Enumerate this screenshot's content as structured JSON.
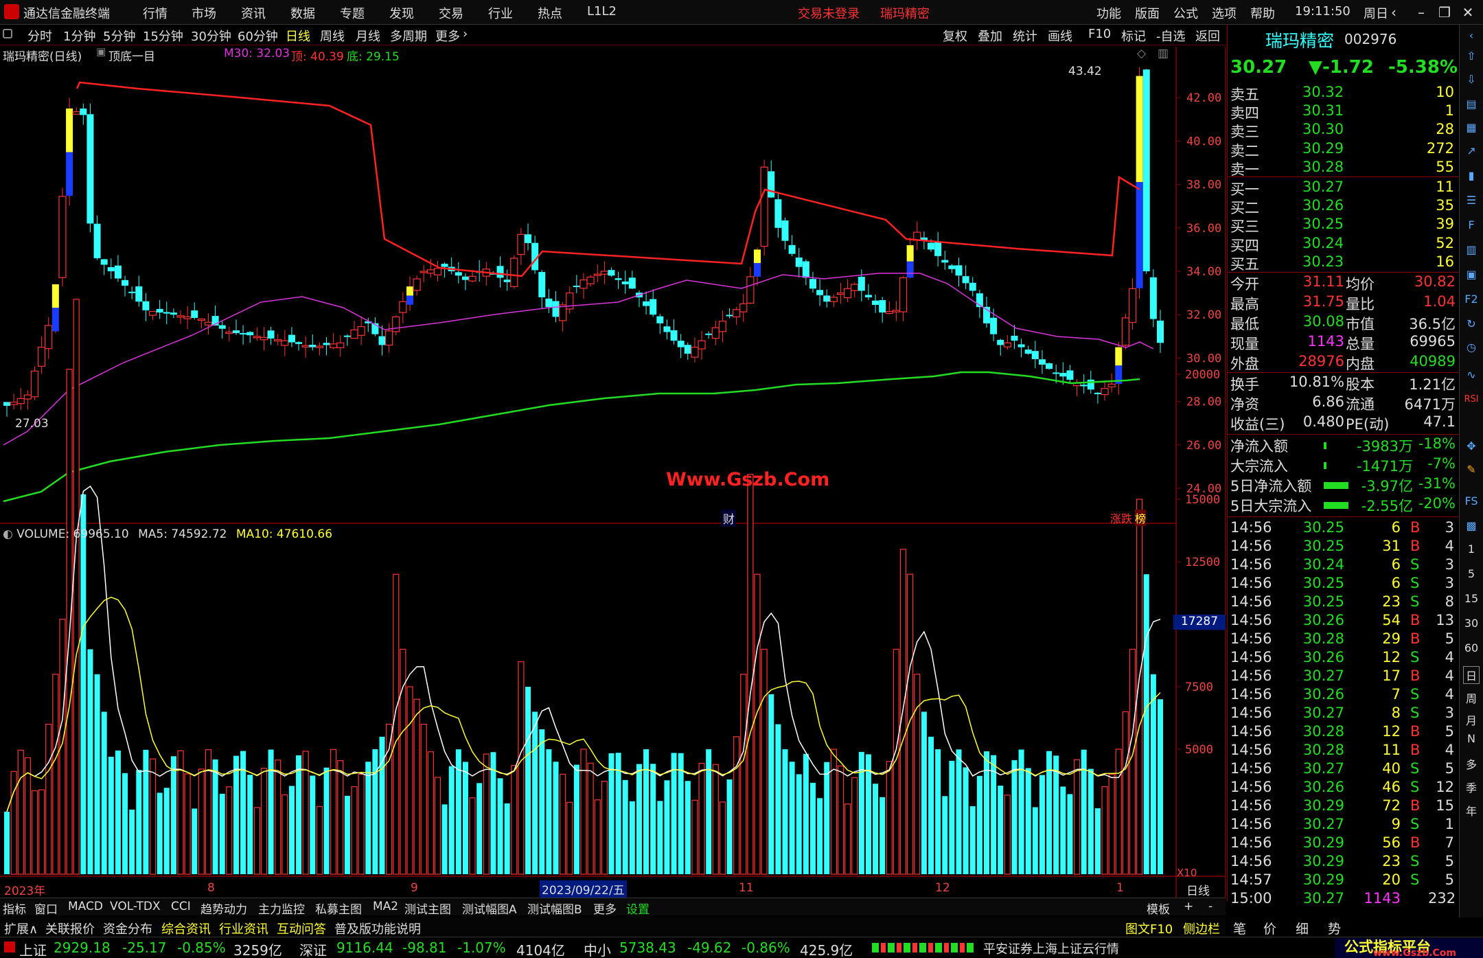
{
  "menubar": {
    "app_title": "通达信金融终端",
    "items": [
      "行情",
      "市场",
      "资讯",
      "数据",
      "专题",
      "发现",
      "交易",
      "行业",
      "热点",
      "L1L2"
    ],
    "trade_status": "交易未登录",
    "stock_name": "瑞玛精密",
    "right_items": [
      "功能",
      "版面",
      "公式",
      "选项",
      "帮助"
    ],
    "time": "19:11:50",
    "weekday": "周日"
  },
  "toolbar": {
    "periods": [
      "分时",
      "1分钟",
      "5分钟",
      "15分钟",
      "30分钟",
      "60分钟",
      "日线",
      "周线",
      "月线",
      "多周期",
      "更多"
    ],
    "active": "日线",
    "right": [
      "复权",
      "叠加",
      "统计",
      "画线",
      "F10",
      "标记",
      "-自选",
      "返回"
    ]
  },
  "chart": {
    "title": "瑞玛精密(日线)",
    "indicator": "顶底一目",
    "m30_label": "M30: 32.03",
    "top_label": "顶: 40.39",
    "bottom_label": "底: 29.15",
    "price_ticks": [
      "42.00",
      "40.00",
      "38.00",
      "36.00",
      "34.00",
      "32.00",
      "30.00",
      "28.00",
      "26.00",
      "24.00"
    ],
    "high_marker": "43.42",
    "low_marker": "27.03",
    "watermark": "Www.Gszb.Com",
    "cai_label": "财",
    "rank_label": "涨跌",
    "bang_label": "榜",
    "volume_header": "VOLUME: 69965.10",
    "ma5_header": "MA5: 74592.72",
    "ma10_header": "MA10: 47610.66",
    "vol_ticks": [
      "20000",
      "15000",
      "12500",
      "10000",
      "7500",
      "5000"
    ],
    "vol_marker": "17287",
    "vol_unit": "X10",
    "date_labels": [
      "2023年",
      "8",
      "9",
      "2023/09/22/五",
      "11",
      "12",
      "1"
    ],
    "period_label": "日线",
    "colors": {
      "up": "#ff3333",
      "down": "#33ffff",
      "ma_top": "#ff2222",
      "ma30": "#dd33dd",
      "bottom": "#22dd22"
    }
  },
  "quote": {
    "name": "瑞玛精密",
    "code": "002976",
    "price": "30.27",
    "change": "▼-1.72",
    "pct": "-5.38%",
    "asks": [
      {
        "label": "卖五",
        "price": "30.32",
        "vol": "10"
      },
      {
        "label": "卖四",
        "price": "30.31",
        "vol": "1"
      },
      {
        "label": "卖三",
        "price": "30.30",
        "vol": "28"
      },
      {
        "label": "卖二",
        "price": "30.29",
        "vol": "272"
      },
      {
        "label": "卖一",
        "price": "30.28",
        "vol": "55"
      }
    ],
    "bids": [
      {
        "label": "买一",
        "price": "30.27",
        "vol": "11"
      },
      {
        "label": "买二",
        "price": "30.26",
        "vol": "35"
      },
      {
        "label": "买三",
        "price": "30.25",
        "vol": "39"
      },
      {
        "label": "买四",
        "price": "30.24",
        "vol": "52"
      },
      {
        "label": "买五",
        "price": "30.23",
        "vol": "16"
      }
    ],
    "stats": [
      {
        "l1": "今开",
        "v1": "31.11",
        "c1": "r",
        "l2": "均价",
        "v2": "30.82",
        "c2": "r"
      },
      {
        "l1": "最高",
        "v1": "31.75",
        "c1": "r",
        "l2": "量比",
        "v2": "1.04",
        "c2": "r"
      },
      {
        "l1": "最低",
        "v1": "30.08",
        "c1": "g",
        "l2": "市值",
        "v2": "36.5亿",
        "c2": "w"
      },
      {
        "l1": "现量",
        "v1": "1143",
        "c1": "m",
        "l2": "总量",
        "v2": "69965",
        "c2": "w"
      },
      {
        "l1": "外盘",
        "v1": "28976",
        "c1": "r",
        "l2": "内盘",
        "v2": "40989",
        "c2": "g"
      }
    ],
    "stats2": [
      {
        "l1": "换手",
        "v1": "10.81%",
        "l2": "股本",
        "v2": "1.21亿"
      },
      {
        "l1": "净资",
        "v1": "6.86",
        "l2": "流通",
        "v2": "6471万"
      },
      {
        "l1": "收益(三)",
        "v1": "0.480",
        "l2": "PE(动)",
        "v2": "47.1"
      }
    ],
    "flows": [
      {
        "label": "净流入额",
        "value": "-3983万",
        "pct": "-18%"
      },
      {
        "label": "大宗流入",
        "value": "-1471万",
        "pct": "-7%"
      },
      {
        "label": "5日净流入额",
        "value": "-3.97亿",
        "pct": "-31%"
      },
      {
        "label": "5日大宗流入",
        "value": "-2.55亿",
        "pct": "-20%"
      }
    ],
    "ticks": [
      {
        "t": "14:56",
        "p": "30.25",
        "pc": "g",
        "v": "6",
        "s": "B",
        "n": "3"
      },
      {
        "t": "14:56",
        "p": "30.25",
        "pc": "g",
        "v": "31",
        "s": "B",
        "n": "4"
      },
      {
        "t": "14:56",
        "p": "30.24",
        "pc": "g",
        "v": "6",
        "s": "S",
        "n": "3"
      },
      {
        "t": "14:56",
        "p": "30.25",
        "pc": "g",
        "v": "6",
        "s": "S",
        "n": "3"
      },
      {
        "t": "14:56",
        "p": "30.25",
        "pc": "g",
        "v": "23",
        "s": "S",
        "n": "8"
      },
      {
        "t": "14:56",
        "p": "30.26",
        "pc": "g",
        "v": "54",
        "s": "B",
        "n": "13"
      },
      {
        "t": "14:56",
        "p": "30.28",
        "pc": "g",
        "v": "29",
        "s": "B",
        "n": "5"
      },
      {
        "t": "14:56",
        "p": "30.26",
        "pc": "g",
        "v": "12",
        "s": "S",
        "n": "4"
      },
      {
        "t": "14:56",
        "p": "30.27",
        "pc": "g",
        "v": "17",
        "s": "B",
        "n": "4"
      },
      {
        "t": "14:56",
        "p": "30.26",
        "pc": "g",
        "v": "7",
        "s": "S",
        "n": "4"
      },
      {
        "t": "14:56",
        "p": "30.27",
        "pc": "g",
        "v": "8",
        "s": "S",
        "n": "3"
      },
      {
        "t": "14:56",
        "p": "30.28",
        "pc": "g",
        "v": "12",
        "s": "B",
        "n": "5"
      },
      {
        "t": "14:56",
        "p": "30.28",
        "pc": "g",
        "v": "11",
        "s": "B",
        "n": "4"
      },
      {
        "t": "14:56",
        "p": "30.27",
        "pc": "g",
        "v": "40",
        "s": "S",
        "n": "5"
      },
      {
        "t": "14:56",
        "p": "30.26",
        "pc": "g",
        "v": "46",
        "s": "S",
        "n": "12"
      },
      {
        "t": "14:56",
        "p": "30.29",
        "pc": "g",
        "v": "72",
        "s": "B",
        "n": "15"
      },
      {
        "t": "14:56",
        "p": "30.27",
        "pc": "g",
        "v": "9",
        "s": "S",
        "n": "1"
      },
      {
        "t": "14:56",
        "p": "30.29",
        "pc": "g",
        "v": "56",
        "s": "B",
        "n": "7"
      },
      {
        "t": "14:56",
        "p": "30.29",
        "pc": "g",
        "v": "23",
        "s": "S",
        "n": "5"
      },
      {
        "t": "14:57",
        "p": "30.29",
        "pc": "g",
        "v": "20",
        "s": "S",
        "n": "5"
      },
      {
        "t": "15:00",
        "p": "30.27",
        "pc": "g",
        "v": "1143",
        "s": "",
        "n": "232"
      }
    ]
  },
  "bottom_tabs": [
    "指标",
    "窗口",
    "MACD",
    "VOL-TDX",
    "CCI",
    "趋势动力",
    "主力监控",
    "私募主图",
    "MA2",
    "测试主图",
    "测试幅图A",
    "测试幅图B",
    "更多",
    "设置"
  ],
  "bottom_right": [
    "模板",
    "+",
    "-"
  ],
  "ext_tabs": [
    "扩展∧",
    "关联报价",
    "资金分布",
    "综合资讯",
    "行业资讯",
    "互动问答",
    "普及版功能说明"
  ],
  "ext_right": [
    "图文F10",
    "侧边栏《",
    "笔",
    "价",
    "细",
    "势"
  ],
  "status": {
    "sh_label": "上证",
    "sh": "2929.18",
    "sh_chg": "-25.17",
    "sh_pct": "-0.85%",
    "sh_amt": "3259亿",
    "sz_label": "深证",
    "sz": "9116.44",
    "sz_chg": "-98.81",
    "sz_pct": "-1.07%",
    "sz_amt": "4104亿",
    "zx_label": "中小",
    "zx": "5738.43",
    "zx_chg": "-49.62",
    "zx_pct": "-0.86%",
    "zx_amt": "425.9亿",
    "broker": "平安证券上海上证云行情",
    "brand": "公式指标平台",
    "brand_url": "www.Gszb.Com"
  },
  "sidebar": [
    "日",
    "周",
    "月",
    "N",
    "多",
    "季",
    "年"
  ],
  "sidebar_nums": [
    "1",
    "5",
    "15",
    "30",
    "60"
  ]
}
